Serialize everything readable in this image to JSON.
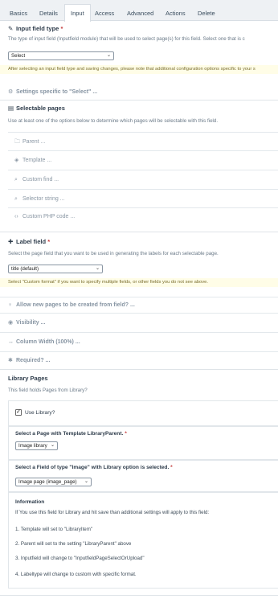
{
  "tabs": [
    "Basics",
    "Details",
    "Input",
    "Access",
    "Advanced",
    "Actions",
    "Delete"
  ],
  "active_tab": "Input",
  "input_field_type": {
    "title": "Input field type",
    "required_mark": "*",
    "description": "The type of input field (Inputfield module) that will be used to select page(s) for this field. Select one that is c",
    "select_value": "Select",
    "note": "After selecting an input field type and saving changes, please note that additional configuration options specific to your s"
  },
  "settings_specific": "Settings specific to \"Select\" ...",
  "selectable_pages": {
    "title": "Selectable pages",
    "description": "Use at least one of the options below to determine which pages will be selectable with this field.",
    "items": [
      "Parent ...",
      "Template ...",
      "Custom find ...",
      "Selector string ...",
      "Custom PHP code ..."
    ]
  },
  "label_field": {
    "title": "Label field",
    "required_mark": "*",
    "description": "Select the page field that you want to be used in generating the labels for each selectable page.",
    "select_value": "title (default)",
    "note": "Select \"Custom format\" if you want to specify multiple fields, or other fields you do not see above."
  },
  "collapsed_rows": [
    "Allow new pages to be created from field? ...",
    "Visibility ...",
    "Column Width (100%) ...",
    "Required? ..."
  ],
  "library_pages": {
    "title": "Library Pages",
    "description": "This field holds Pages from Library?",
    "use_library_label": "Use Library?",
    "parent_title": "Select a Page with Template LibraryParent.",
    "parent_value": "Image library",
    "field_title": "Select a Field of type \"Image\" with Library option is selected.",
    "field_value": "Image page (image_page)",
    "info_title": "Information",
    "info_intro": "If You use this field for Library and hit save than additional settings will apply to this field:",
    "info_lines": [
      "1. Template will set to \"LibraryItem\"",
      "2. Parent will set to the setting \"LibraryParent\" above",
      "3. Inputfield will change to \"InputfieldPageSelectOrUpload\"",
      "4. Labeltype will change to custom with specific format."
    ]
  },
  "colors": {
    "accent": "#eef1f4",
    "note_bg": "#fffde7",
    "required": "#c43b3b"
  }
}
